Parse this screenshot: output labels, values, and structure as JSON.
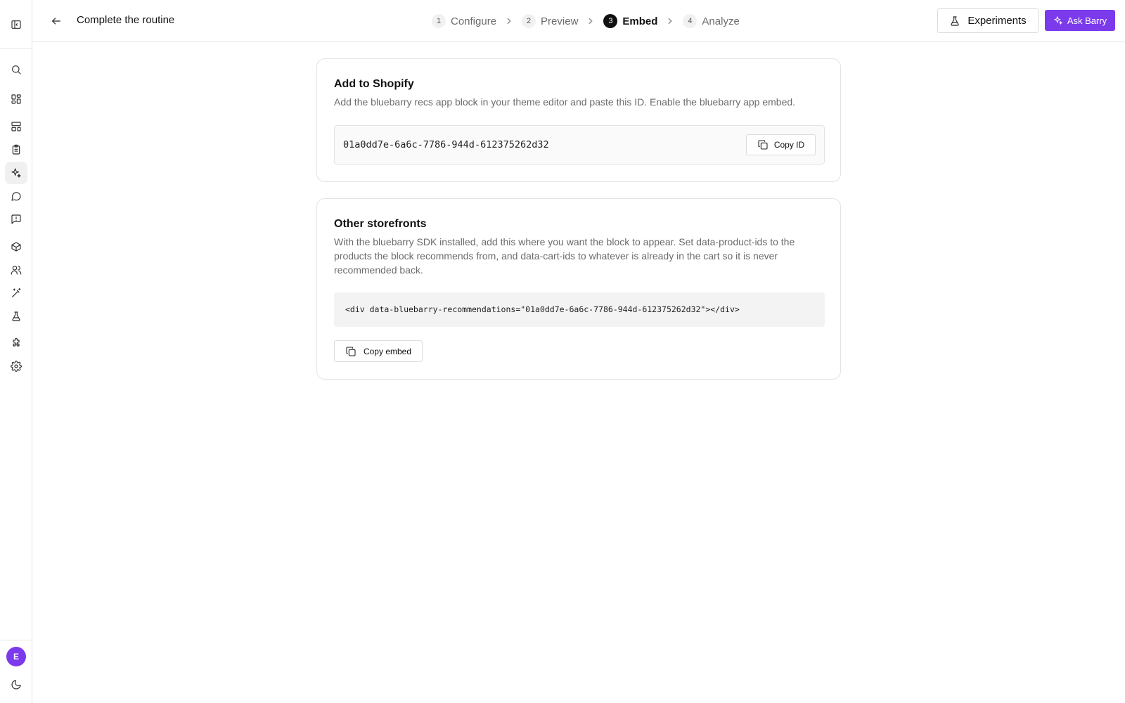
{
  "sidebar": {
    "items": [
      {
        "name": "search-icon"
      },
      {
        "name": "dashboard-icon"
      },
      {
        "name": "layout-icon"
      },
      {
        "name": "clipboard-icon"
      },
      {
        "name": "sparkles-icon",
        "active": true
      },
      {
        "name": "message-circle-icon"
      },
      {
        "name": "message-square-icon"
      },
      {
        "name": "package-icon"
      },
      {
        "name": "users-icon"
      },
      {
        "name": "wand-icon"
      },
      {
        "name": "flask-icon"
      },
      {
        "name": "puzzle-icon"
      },
      {
        "name": "settings-icon"
      }
    ],
    "avatar_initial": "E"
  },
  "header": {
    "title": "Complete the routine",
    "steps": [
      {
        "number": "1",
        "label": "Configure"
      },
      {
        "number": "2",
        "label": "Preview"
      },
      {
        "number": "3",
        "label": "Embed",
        "active": true
      },
      {
        "number": "4",
        "label": "Analyze"
      }
    ],
    "experiments_label": "Experiments",
    "ask_label": "Ask Barry"
  },
  "shopify": {
    "title": "Add to Shopify",
    "description": "Add the bluebarry recs app block in your theme editor and paste this ID. Enable the bluebarry app embed.",
    "id_value": "01a0dd7e-6a6c-7786-944d-612375262d32",
    "copy_label": "Copy ID"
  },
  "storefronts": {
    "title": "Other storefronts",
    "description": "With the bluebarry SDK installed, add this where you want the block to appear. Set data-product-ids to the products the block recommends from, and data-cart-ids to whatever is already in the cart so it is never recommended back.",
    "code": "<div data-bluebarry-recommendations=\"01a0dd7e-6a6c-7786-944d-612375262d32\"></div>",
    "copy_label": "Copy embed"
  },
  "colors": {
    "accent": "#7c3aed",
    "border": "#e3e3e3",
    "muted_text": "#6b6b6b"
  }
}
